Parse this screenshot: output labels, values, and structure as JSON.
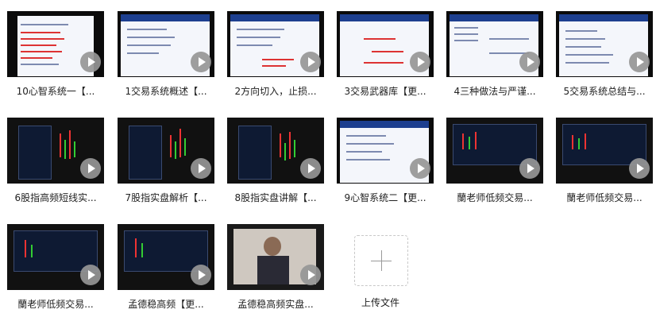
{
  "files": [
    {
      "title": "10心智系统一【..."
    },
    {
      "title": "1交易系统概述【..."
    },
    {
      "title": "2方向切入，止损..."
    },
    {
      "title": "3交易武器库【更..."
    },
    {
      "title": "4三种做法与严谨..."
    },
    {
      "title": "5交易系统总结与..."
    },
    {
      "title": "6股指高频短线实..."
    },
    {
      "title": "7股指实盘解析【..."
    },
    {
      "title": "8股指实盘讲解【..."
    },
    {
      "title": "9心智系统二【更..."
    },
    {
      "title": "蘭老师低频交易..."
    },
    {
      "title": "蘭老师低频交易..."
    },
    {
      "title": "蘭老师低频交易..."
    },
    {
      "title": "孟德稳高频【更..."
    },
    {
      "title": "孟德稳高频实盘..."
    }
  ],
  "upload": {
    "label": "上传文件"
  }
}
